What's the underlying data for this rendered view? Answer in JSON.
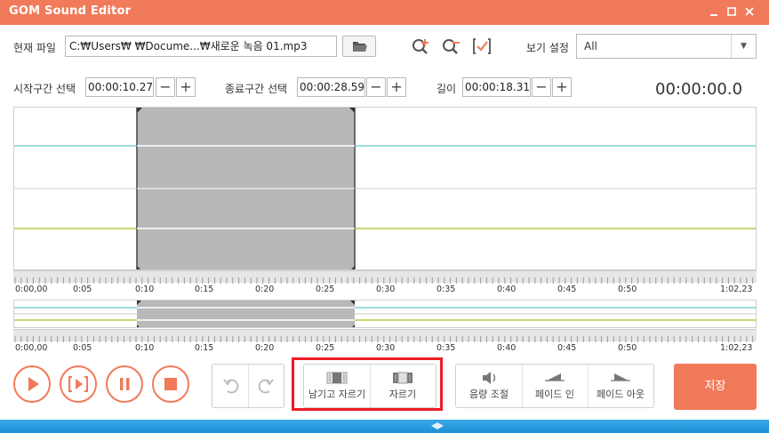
{
  "app": {
    "title": "GOM Sound Editor"
  },
  "file": {
    "label": "현재 파일",
    "path": "C:₩Users₩          ₩Docume...₩새로운 녹음 01.mp3"
  },
  "view": {
    "label": "보기 설정",
    "selected": "All"
  },
  "selection": {
    "start_label": "시작구간 선택",
    "start_value": "00:00:10.27",
    "end_label": "종료구간 선택",
    "end_value": "00:00:28.59",
    "length_label": "길이",
    "length_value": "00:00:18.31"
  },
  "stepper": {
    "minus": "−",
    "plus": "+"
  },
  "current_time": "00:00:00.0",
  "timeline": {
    "ticks": [
      "0:00,00",
      "0:05",
      "0:10",
      "0:15",
      "0:20",
      "0:25",
      "0:30",
      "0:35",
      "0:40",
      "0:45",
      "0:50",
      "1:02,23"
    ]
  },
  "edit": {
    "keep_cut": "남기고 자르기",
    "cut": "자르기",
    "volume": "음량 조절",
    "fade_in": "페이드 인",
    "fade_out": "페이드 아웃",
    "save": "저장"
  },
  "colors": {
    "accent": "#f07a5a",
    "highlight": "#ee1c25",
    "channel1": "#7fd3d3",
    "channel2": "#b6c94a",
    "selection": "#b8b8b8"
  }
}
